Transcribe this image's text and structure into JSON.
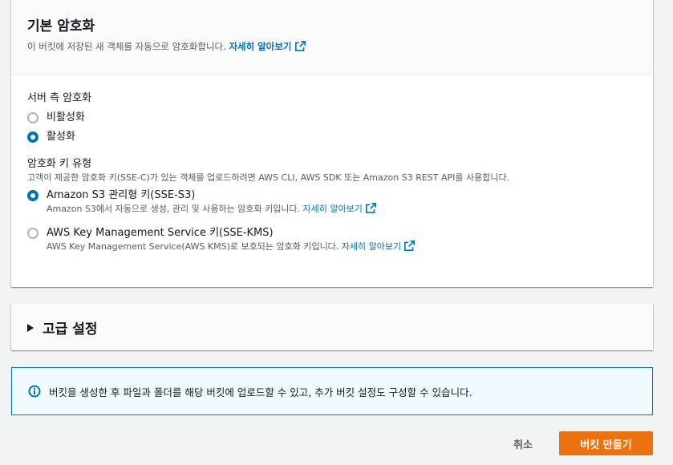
{
  "encryption": {
    "title": "기본 암호화",
    "description": "이 버킷에 저장된 새 객체를 자동으로 암호화합니다.",
    "learn_more": "자세히 알아보기",
    "server_side": {
      "label": "서버 측 암호화",
      "options": [
        {
          "label": "비활성화",
          "checked": false
        },
        {
          "label": "활성화",
          "checked": true
        }
      ]
    },
    "key_type": {
      "label": "암호화 키 유형",
      "hint": "고객이 제공한 암호화 키(SSE-C)가 있는 객체를 업로드하려면 AWS CLI, AWS SDK 또는 Amazon S3 REST API를 사용합니다.",
      "options": [
        {
          "label": "Amazon S3 관리형 키(SSE-S3)",
          "description": "Amazon S3에서 자동으로 생성, 관리 및 사용하는 암호화 키입니다.",
          "learn_more": "자세히 알아보기",
          "checked": true
        },
        {
          "label": "AWS Key Management Service 키(SSE-KMS)",
          "description": "AWS Key Management Service(AWS KMS)로 보호되는 암호화 키입니다.",
          "learn_more": "자세히 알아보기",
          "checked": false
        }
      ]
    }
  },
  "advanced": {
    "title": "고급 설정"
  },
  "info": {
    "text": "버킷을 생성한 후 파일과 폴더를 해당 버킷에 업로드할 수 있고, 추가 버킷 설정도 구성할 수 있습니다."
  },
  "actions": {
    "cancel": "취소",
    "create": "버킷 만들기"
  },
  "colors": {
    "link": "#0073bb",
    "primary": "#ec7211",
    "info_border": "#0073bb",
    "info_bg": "#f1faff"
  },
  "icons": {
    "external": "external-link-icon",
    "info": "info-icon",
    "caret": "caret-right-icon"
  }
}
